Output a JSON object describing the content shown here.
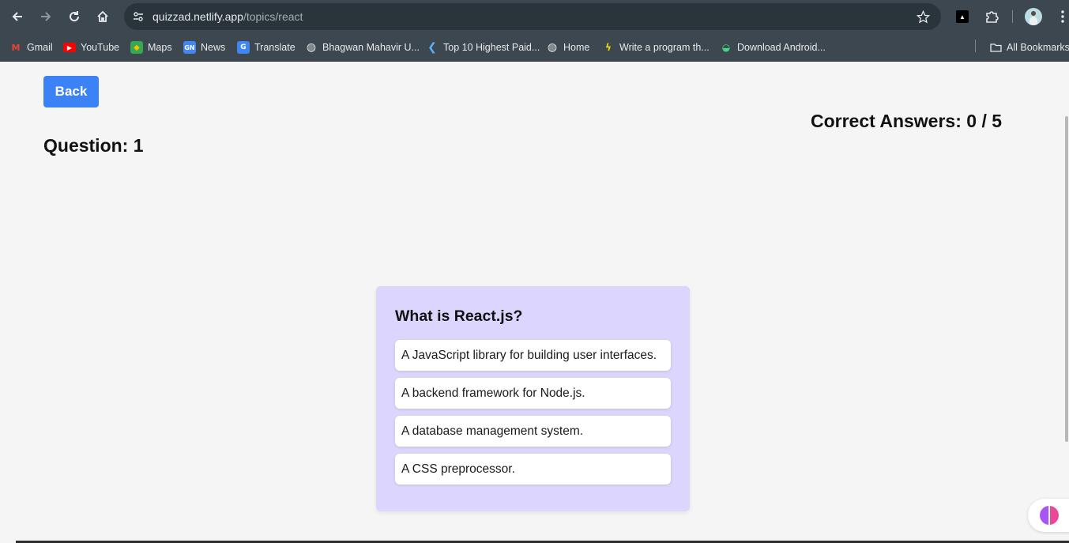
{
  "browser": {
    "url_domain": "quizzad.netlify.app",
    "url_path": "/topics/react",
    "icons": {
      "back": "arrow-left-icon",
      "forward": "arrow-right-icon",
      "reload": "reload-icon",
      "home": "home-icon",
      "site_info": "tune-icon",
      "bookmark": "star-icon",
      "extensions": "puzzle-icon",
      "menu": "kebab-menu-icon"
    },
    "bookmarks": [
      {
        "label": "Gmail",
        "icon": "gmail-icon"
      },
      {
        "label": "YouTube",
        "icon": "youtube-icon"
      },
      {
        "label": "Maps",
        "icon": "maps-icon"
      },
      {
        "label": "News",
        "icon": "news-icon"
      },
      {
        "label": "Translate",
        "icon": "translate-icon"
      },
      {
        "label": "Bhagwan Mahavir U...",
        "icon": "globe-icon"
      },
      {
        "label": "Top 10 Highest Paid...",
        "icon": "site-icon"
      },
      {
        "label": "Home",
        "icon": "globe-icon"
      },
      {
        "label": "Write a program th...",
        "icon": "site-icon"
      },
      {
        "label": "Download Android...",
        "icon": "android-icon"
      }
    ],
    "all_bookmarks": "All Bookmarks"
  },
  "page": {
    "back_label": "Back",
    "question_label": "Question: 1",
    "score_label": "Correct Answers: 0 / 5",
    "question_text": "What is React.js?",
    "options": [
      "A JavaScript library for building user interfaces.",
      "A backend framework for Node.js.",
      "A database management system.",
      "A CSS preprocessor."
    ]
  },
  "colors": {
    "accent": "#3b82f6",
    "card_bg": "#dcd6fe",
    "chrome_bg": "#3c474f"
  }
}
